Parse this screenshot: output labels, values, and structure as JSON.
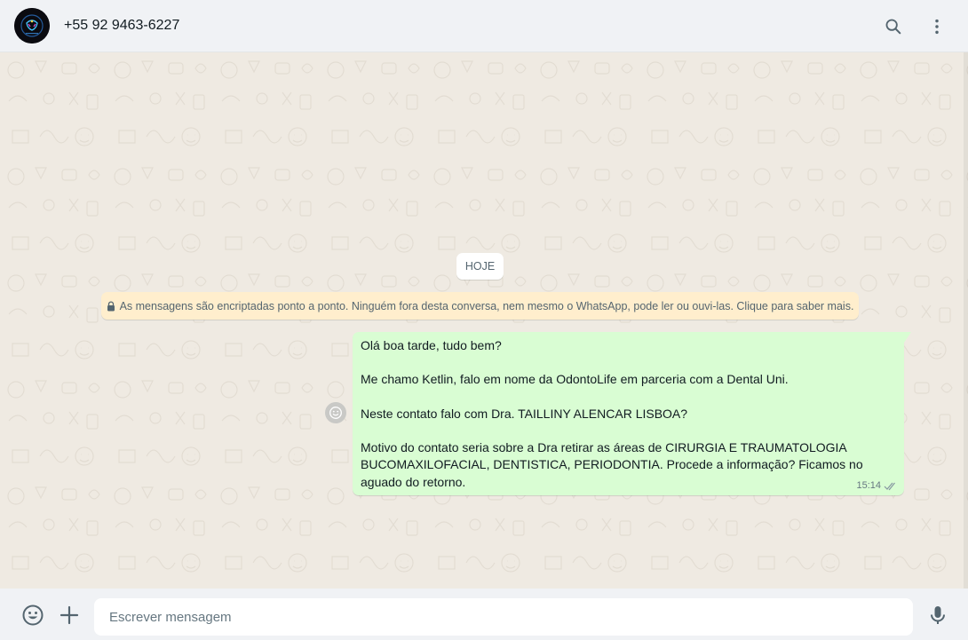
{
  "header": {
    "contact_name": "+55 92 9463-6227",
    "search_icon": "search-icon",
    "menu_icon": "vertical-dots-icon"
  },
  "chat": {
    "date_chip": "HOJE",
    "encryption_notice": "As mensagens são encriptadas ponto a ponto. Ninguém fora desta conversa, nem mesmo o WhatsApp, pode ler ou ouvi-las. Clique para saber mais.",
    "messages": [
      {
        "direction": "outgoing",
        "text": "Olá boa tarde, tudo bem?\n\nMe chamo Ketlin, falo em nome da OdontoLife em parceria com a Dental Uni.\n\nNeste contato falo com Dra. TAILLINY ALENCAR LISBOA?\n\nMotivo do contato seria sobre a Dra retirar as áreas de CIRURGIA E TRAUMATOLOGIA BUCOMAXILOFACIAL, DENTISTICA, PERIODONTIA. Procede a informação? Ficamos no aguado do retorno.",
        "time": "15:14",
        "status_icon": "double-check-icon"
      }
    ]
  },
  "footer": {
    "placeholder": "Escrever mensagem",
    "value": ""
  },
  "colors": {
    "outgoing_bubble": "#d9fdd3",
    "chat_background": "#efeae2",
    "encryption_notice": "#ffeecd",
    "header_footer": "#f0f2f5"
  }
}
